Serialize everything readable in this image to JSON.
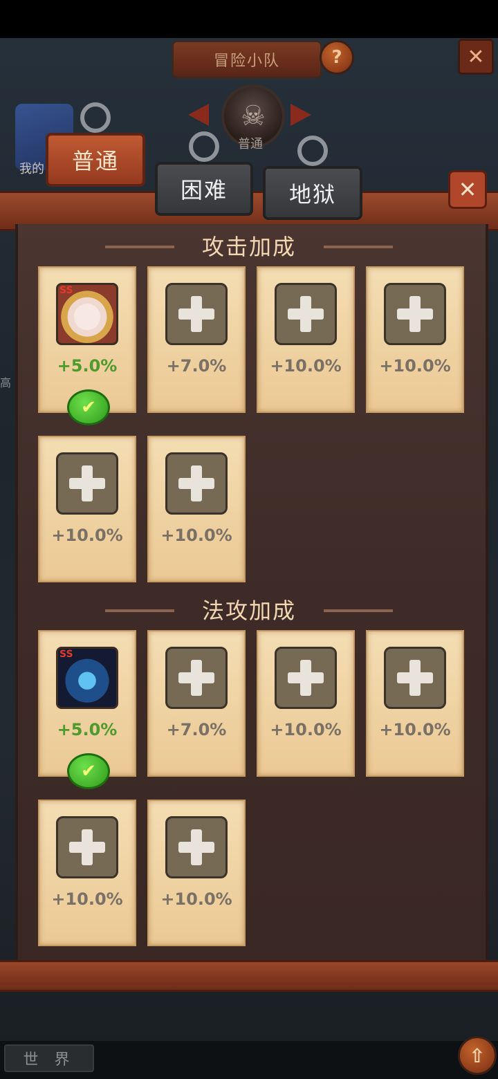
{
  "header": {
    "title": "冒险小队",
    "help_label": "?",
    "close_label": "✕"
  },
  "difficulty": {
    "current": "普通",
    "prev_icon": "chevron-left-icon",
    "next_icon": "chevron-right-icon",
    "skull_icon": "☠"
  },
  "side": {
    "my_label": "我的",
    "partial_text": "高"
  },
  "tabs": [
    {
      "label": "普通",
      "active": true
    },
    {
      "label": "困难",
      "active": false
    },
    {
      "label": "地狱",
      "active": false
    }
  ],
  "board": {
    "close_label": "✕"
  },
  "sections": [
    {
      "title": "攻击加成",
      "slots": [
        {
          "filled": true,
          "rank": "SS",
          "bonus": "+5.0%",
          "checked": true
        },
        {
          "filled": false,
          "bonus": "+7.0%"
        },
        {
          "filled": false,
          "bonus": "+10.0%"
        },
        {
          "filled": false,
          "bonus": "+10.0%"
        },
        {
          "filled": false,
          "bonus": "+10.0%"
        },
        {
          "filled": false,
          "bonus": "+10.0%"
        }
      ]
    },
    {
      "title": "法攻加成",
      "slots": [
        {
          "filled": true,
          "rank": "SS",
          "bonus": "+5.0%",
          "checked": true
        },
        {
          "filled": false,
          "bonus": "+7.0%"
        },
        {
          "filled": false,
          "bonus": "+10.0%"
        },
        {
          "filled": false,
          "bonus": "+10.0%"
        },
        {
          "filled": false,
          "bonus": "+10.0%"
        },
        {
          "filled": false,
          "bonus": "+10.0%"
        }
      ]
    }
  ],
  "chat": {
    "channel": "世 界",
    "send_icon": "⇧"
  },
  "check_icon": "✔"
}
